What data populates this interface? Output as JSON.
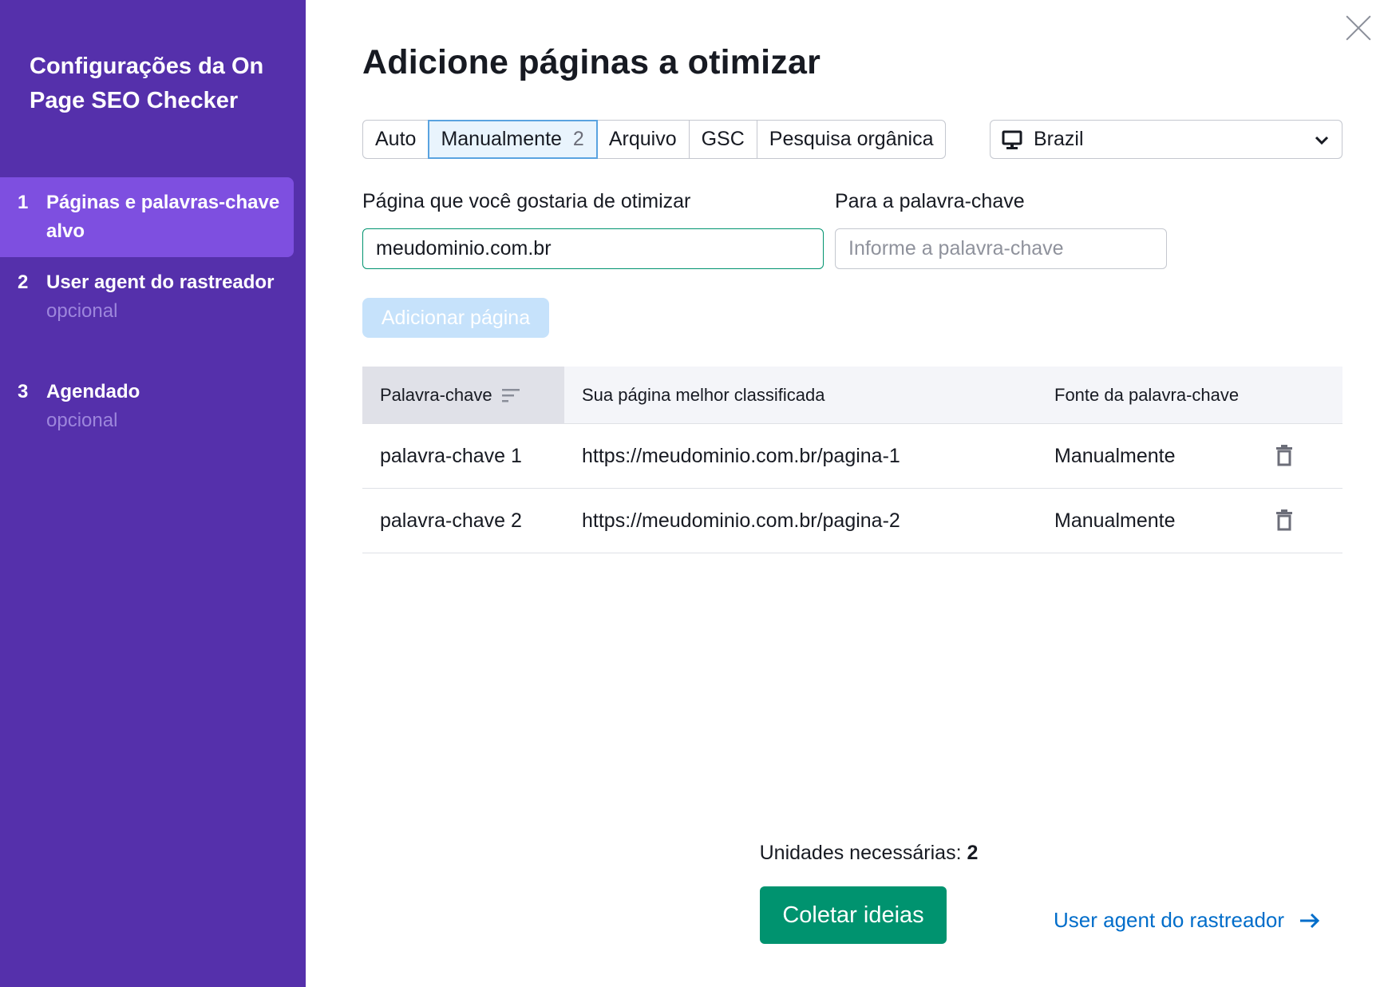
{
  "sidebar": {
    "title": "Configurações da On Page SEO Checker",
    "steps": [
      {
        "num": "1",
        "label": "Páginas e palavras-chave alvo",
        "optional": ""
      },
      {
        "num": "2",
        "label": "User agent do rastreador",
        "optional": "opcional"
      },
      {
        "num": "3",
        "label": "Agendado",
        "optional": "opcional"
      }
    ]
  },
  "main": {
    "title": "Adicione páginas a otimizar",
    "tabs": [
      {
        "label": "Auto"
      },
      {
        "label": "Manualmente",
        "count": "2"
      },
      {
        "label": "Arquivo"
      },
      {
        "label": "GSC"
      },
      {
        "label": "Pesquisa orgânica"
      }
    ],
    "location": {
      "value": "Brazil",
      "icon": "desktop-icon"
    },
    "page_field": {
      "label": "Página que você gostaria de otimizar",
      "value": "meudominio.com.br"
    },
    "keyword_field": {
      "label": "Para a palavra-chave",
      "placeholder": "Informe a palavra-chave"
    },
    "add_button": "Adicionar página",
    "table": {
      "headers": [
        "Palavra-chave",
        "Sua página melhor classificada",
        "Fonte da palavra-chave"
      ],
      "rows": [
        {
          "keyword": "palavra-chave 1",
          "url": "https://meudominio.com.br/pagina-1",
          "source": "Manualmente"
        },
        {
          "keyword": "palavra-chave 2",
          "url": "https://meudominio.com.br/pagina-2",
          "source": "Manualmente"
        }
      ]
    },
    "units_label": "Unidades necessárias:",
    "units_value": "2",
    "collect_button": "Coletar ideias",
    "next_link": "User agent do rastreador"
  },
  "colors": {
    "sidebar_bg": "#5530ab",
    "sidebar_active": "#7e4fe0",
    "primary_green": "#00936f",
    "link_blue": "#006dca",
    "disabled_button": "#c6e2fb"
  }
}
